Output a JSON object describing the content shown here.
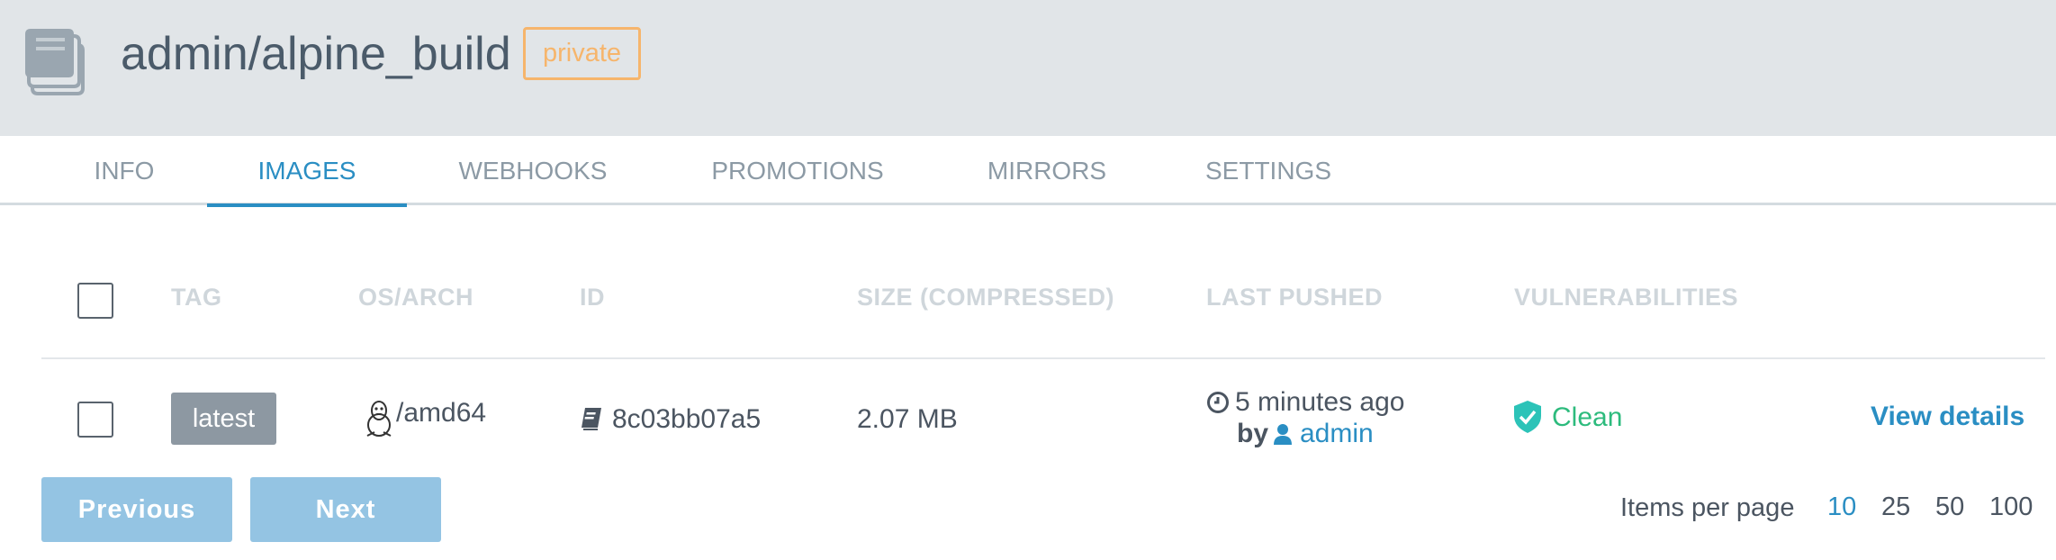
{
  "header": {
    "repo_name": "admin/alpine_build",
    "visibility_badge": "private",
    "icon": "stacked-books-icon"
  },
  "tabs": [
    {
      "label": "INFO",
      "active": false
    },
    {
      "label": "IMAGES",
      "active": true
    },
    {
      "label": "WEBHOOKS",
      "active": false
    },
    {
      "label": "PROMOTIONS",
      "active": false
    },
    {
      "label": "MIRRORS",
      "active": false
    },
    {
      "label": "SETTINGS",
      "active": false
    }
  ],
  "table": {
    "columns": [
      "TAG",
      "OS/ARCH",
      "ID",
      "SIZE (COMPRESSED)",
      "LAST PUSHED",
      "VULNERABILITIES"
    ],
    "rows": [
      {
        "tag": "latest",
        "os_arch": "/amd64",
        "os_icon": "linux-penguin-icon",
        "id": "8c03bb07a5",
        "id_icon": "book-icon",
        "size": "2.07 MB",
        "last_pushed": "5 minutes ago",
        "pushed_by_prefix": "by",
        "pushed_by": "admin",
        "vulnerabilities": "Clean",
        "action": "View details"
      }
    ]
  },
  "pagination": {
    "previous_label": "Previous",
    "next_label": "Next",
    "items_per_page_label": "Items per page",
    "options": [
      "10",
      "25",
      "50",
      "100"
    ],
    "selected": "10"
  },
  "colors": {
    "accent": "#2a8ec3",
    "private_badge": "#f6b56c",
    "clean": "#2dbb7d",
    "header_bg": "#e1e5e8"
  }
}
